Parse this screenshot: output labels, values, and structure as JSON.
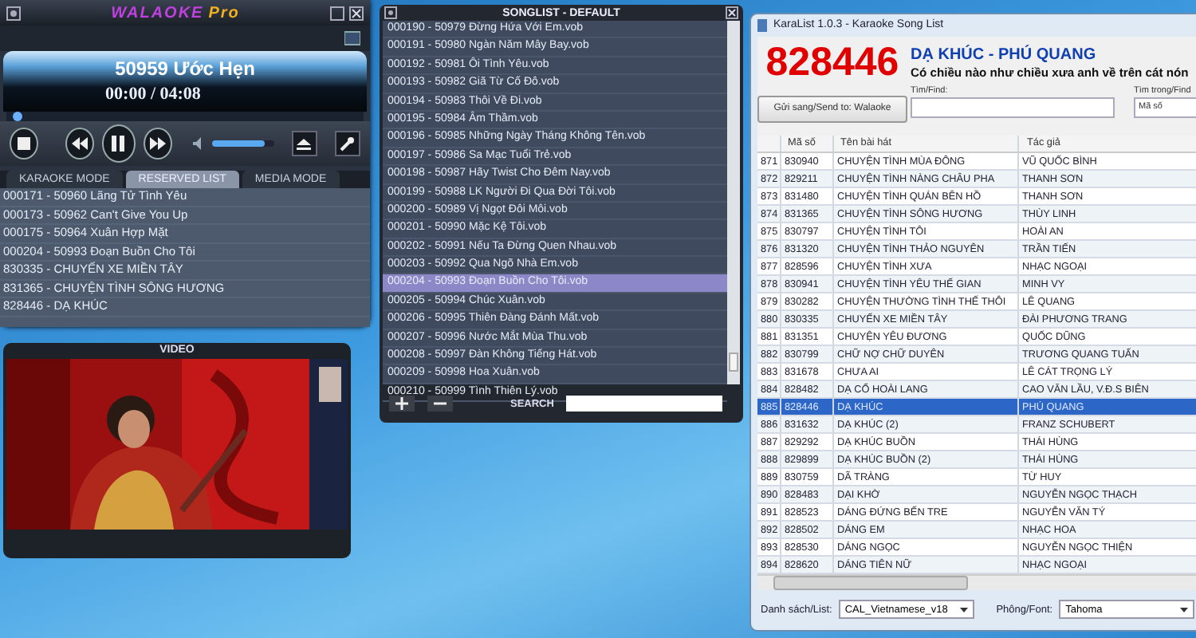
{
  "player": {
    "logo": "WALAOKE",
    "logo_suffix": "Pro",
    "song_title": "50959 Ước Hẹn",
    "time": "00:00 / 04:08",
    "progress": {
      "level": 0.02
    },
    "volume": {
      "level": 0.85
    },
    "tabs": [
      {
        "label": "KARAOKE MODE",
        "selected": false
      },
      {
        "label": "RESERVED LIST",
        "selected": true
      },
      {
        "label": "MEDIA MODE",
        "selected": false
      }
    ],
    "reserved": [
      "000171 - 50960 Lãng Tử Tình Yêu",
      "000173 - 50962 Can't Give You Up",
      "000175 - 50964 Xuân Hợp Mặt",
      "000204 - 50993 Đoạn Buồn Cho Tôi",
      "830335 - CHUYẾN XE MIỀN TÂY",
      "831365 - CHUYỆN TÌNH SÔNG HƯƠNG",
      "828446 - DẠ KHÚC"
    ]
  },
  "video": {
    "title": "VIDEO",
    "kind": "picture"
  },
  "songlist": {
    "title": "SONGLIST - DEFAULT",
    "search_label": "SEARCH",
    "items": [
      {
        "text": "000190 - 50979 Đừng Hứa Với Em.vob",
        "selected": false
      },
      {
        "text": "000191 - 50980 Ngàn Năm Mây Bay.vob",
        "selected": false
      },
      {
        "text": "000192 - 50981 Ôi Tình Yêu.vob",
        "selected": false
      },
      {
        "text": "000193 - 50982 Giã Từ Cố Đô.vob",
        "selected": false
      },
      {
        "text": "000194 - 50983 Thôi Về Đi.vob",
        "selected": false
      },
      {
        "text": "000195 - 50984 Âm Thầm.vob",
        "selected": false
      },
      {
        "text": "000196 - 50985 Những Ngày Tháng Không Tên.vob",
        "selected": false
      },
      {
        "text": "000197 - 50986 Sa Mạc Tuổi Trẻ.vob",
        "selected": false
      },
      {
        "text": "000198 - 50987 Hãy Twist Cho Đêm Nay.vob",
        "selected": false
      },
      {
        "text": "000199 - 50988 LK Người Đi Qua Đời Tôi.vob",
        "selected": false
      },
      {
        "text": "000200 - 50989 Vị Ngọt Đôi Môi.vob",
        "selected": false
      },
      {
        "text": "000201 - 50990 Mặc Kệ Tôi.vob",
        "selected": false
      },
      {
        "text": "000202 - 50991 Nếu Ta Đừng Quen Nhau.vob",
        "selected": false
      },
      {
        "text": "000203 - 50992 Qua Ngõ Nhà Em.vob",
        "selected": false
      },
      {
        "text": "000204 - 50993 Đoạn Buồn Cho Tôi.vob",
        "selected": true
      },
      {
        "text": "000205 - 50994 Chúc Xuân.vob",
        "selected": false
      },
      {
        "text": "000206 - 50995 Thiên Đàng Đánh Mất.vob",
        "selected": false
      },
      {
        "text": "000207 - 50996 Nước Mắt Mùa Thu.vob",
        "selected": false
      },
      {
        "text": "000208 - 50997 Đàn Không Tiếng Hát.vob",
        "selected": false
      },
      {
        "text": "000209 - 50998 Hoa Xuân.vob",
        "selected": false
      },
      {
        "text": "000210 - 50999 Tình Thiên Lý.vob",
        "selected": false
      }
    ]
  },
  "karalist": {
    "title": "KaraList 1.0.3 - Karaoke Song List",
    "code": "828446",
    "song": "DẠ KHÚC - PHÚ QUANG",
    "lyric": "Có chiều nào như chiều xưa anh về trên cát nón",
    "send_button": "Gửi sang/Send to: Walaoke",
    "find_label": "Tìm/Find:",
    "find_in_label": "Tìm trong/Find",
    "find_in_value": "Mã số",
    "columns": [
      "Mã số",
      "Tên bài hát",
      "Tác giả"
    ],
    "rows": [
      {
        "index": "871",
        "code": "830940",
        "title": "CHUYỆN TÌNH MÙA ĐÔNG",
        "author": "VŨ QUỐC BÌNH",
        "selected": false
      },
      {
        "index": "872",
        "code": "829211",
        "title": "CHUYỆN TÌNH NÀNG CHÂU PHA",
        "author": "THANH SƠN",
        "selected": false
      },
      {
        "index": "873",
        "code": "831480",
        "title": "CHUYỆN TÌNH QUÁN BÊN HỒ",
        "author": "THANH SƠN",
        "selected": false
      },
      {
        "index": "874",
        "code": "831365",
        "title": "CHUYỆN TÌNH SÔNG HƯƠNG",
        "author": "THÙY LINH",
        "selected": false
      },
      {
        "index": "875",
        "code": "830797",
        "title": "CHUYỆN TÌNH TÔI",
        "author": "HOÀI AN",
        "selected": false
      },
      {
        "index": "876",
        "code": "831320",
        "title": "CHUYỆN TÌNH THẢO NGUYÊN",
        "author": "TRẦN TIẾN",
        "selected": false
      },
      {
        "index": "877",
        "code": "828596",
        "title": "CHUYỆN TÌNH XƯA",
        "author": "NHẠC NGOẠI",
        "selected": false
      },
      {
        "index": "878",
        "code": "830941",
        "title": "CHUYỆN TÌNH YÊU THẾ GIAN",
        "author": "MINH VY",
        "selected": false
      },
      {
        "index": "879",
        "code": "830282",
        "title": "CHUYỆN THƯỜNG TÌNH THẾ THÔI",
        "author": "LÊ QUANG",
        "selected": false
      },
      {
        "index": "880",
        "code": "830335",
        "title": "CHUYẾN XE MIỀN TÂY",
        "author": "ĐÀI PHƯƠNG TRANG",
        "selected": false
      },
      {
        "index": "881",
        "code": "831351",
        "title": "CHUYỆN YÊU ĐƯƠNG",
        "author": "QUỐC DŨNG",
        "selected": false
      },
      {
        "index": "882",
        "code": "830799",
        "title": "CHỮ NỢ CHỮ DUYÊN",
        "author": "TRƯƠNG QUANG TUẤN",
        "selected": false
      },
      {
        "index": "883",
        "code": "831678",
        "title": "CHƯA AI",
        "author": "LÊ CÁT TRỌNG LÝ",
        "selected": false
      },
      {
        "index": "884",
        "code": "828482",
        "title": "DẠ CỔ HOÀI LANG",
        "author": "CAO VĂN LẦU, V.Đ.S BIÊN",
        "selected": false
      },
      {
        "index": "885",
        "code": "828446",
        "title": "DẠ KHÚC",
        "author": "PHÚ QUANG",
        "selected": true
      },
      {
        "index": "886",
        "code": "831632",
        "title": "DẠ KHÚC (2)",
        "author": "FRANZ SCHUBERT",
        "selected": false
      },
      {
        "index": "887",
        "code": "829292",
        "title": "DẠ KHÚC BUỒN",
        "author": "THÁI HÙNG",
        "selected": false
      },
      {
        "index": "888",
        "code": "829899",
        "title": "DẠ KHÚC BUỒN (2)",
        "author": "THÁI HÙNG",
        "selected": false
      },
      {
        "index": "889",
        "code": "830759",
        "title": "DÃ TRÀNG",
        "author": "TỪ HUY",
        "selected": false
      },
      {
        "index": "890",
        "code": "828483",
        "title": "DẠI KHỜ",
        "author": "NGUYỄN NGỌC THẠCH",
        "selected": false
      },
      {
        "index": "891",
        "code": "828523",
        "title": "DÁNG ĐỨNG BẾN TRE",
        "author": "NGUYỄN VĂN TÝ",
        "selected": false
      },
      {
        "index": "892",
        "code": "828502",
        "title": "DÁNG EM",
        "author": "NHẠC HOA",
        "selected": false
      },
      {
        "index": "893",
        "code": "828530",
        "title": "DÁNG NGỌC",
        "author": "NGUYỄN NGỌC THIỆN",
        "selected": false
      },
      {
        "index": "894",
        "code": "828620",
        "title": "DÁNG TIÊN NỮ",
        "author": "NHẠC NGOẠI",
        "selected": false
      }
    ],
    "list_label": "Danh sách/List:",
    "list_value": "CAL_Vietnamese_v18",
    "font_label": "Phông/Font:",
    "font_value": "Tahoma"
  }
}
